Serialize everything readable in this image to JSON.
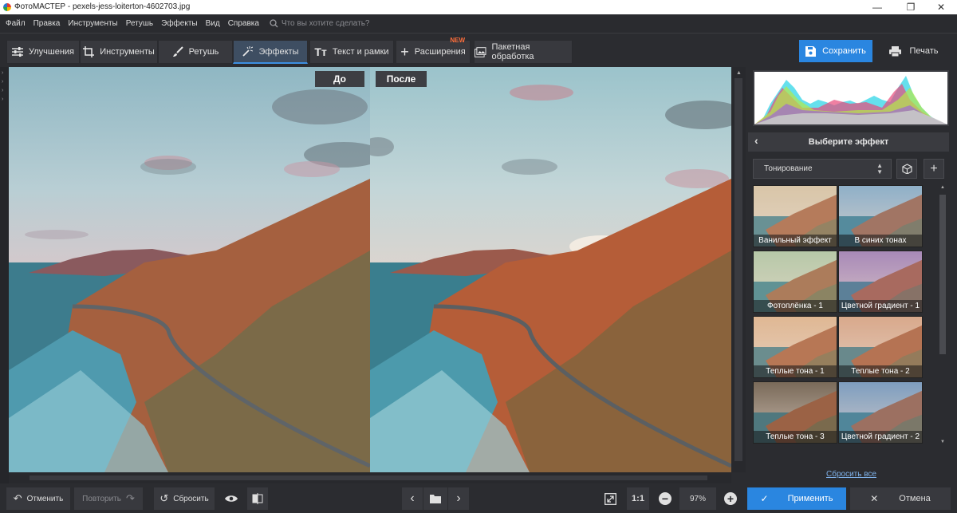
{
  "window": {
    "title": "ФотоМАСТЕР - pexels-jess-loiterton-4602703.jpg",
    "minimize": "—",
    "maximize": "❐",
    "close": "✕"
  },
  "menu": {
    "items": [
      "Файл",
      "Правка",
      "Инструменты",
      "Ретушь",
      "Эффекты",
      "Вид",
      "Справка"
    ],
    "search_placeholder": "Что вы хотите сделать?"
  },
  "toolbar": {
    "tabs": [
      {
        "label": "Улучшения",
        "icon": "sliders-icon"
      },
      {
        "label": "Инструменты",
        "icon": "crop-icon"
      },
      {
        "label": "Ретушь",
        "icon": "brush-icon"
      },
      {
        "label": "Эффекты",
        "icon": "magic-wand-icon",
        "active": true
      },
      {
        "label": "Текст и рамки",
        "icon": "text-icon"
      },
      {
        "label": "Расширения",
        "icon": "plus-icon",
        "badge": "NEW"
      },
      {
        "label": "Пакетная обработка",
        "icon": "batch-image-icon"
      }
    ],
    "save_label": "Сохранить",
    "print_label": "Печать"
  },
  "canvas": {
    "before_label": "До",
    "after_label": "После"
  },
  "panel": {
    "header": "Выберите эффект",
    "category": "Тонирование",
    "effects": [
      "Ванильный эффект",
      "В синих тонах",
      "Фотоплёнка - 1",
      "Цветной градиент - 1",
      "Теплые тона - 1",
      "Теплые тона - 2",
      "Теплые тона - 3",
      "Цветной градиент - 2"
    ],
    "reset_all": "Сбросить все"
  },
  "bottom": {
    "undo_label": "Отменить",
    "redo_label": "Повторить",
    "reset_label": "Сбросить",
    "ratio_label": "1:1",
    "zoom": "97%",
    "apply_label": "Применить",
    "cancel_label": "Отмена"
  },
  "colors": {
    "accent": "#2a86e0",
    "panel_bg": "#2b2c30",
    "button_bg": "#38393e",
    "badge_new": "#ff6f3c"
  }
}
